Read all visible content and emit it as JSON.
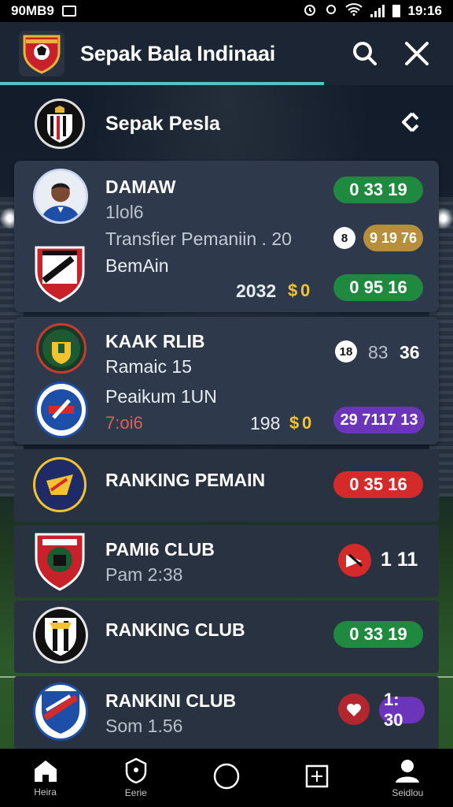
{
  "status_bar": {
    "left_text": "90MB9",
    "time": "19:16"
  },
  "app_bar": {
    "title": "Sepak Bala Indinaai",
    "search_icon": "search-icon",
    "close_icon": "close-icon"
  },
  "section": {
    "title": "Sepak Pesla",
    "action_icon": "share-icon"
  },
  "card1": {
    "name": "DAMAW",
    "line2": "1lol6",
    "line3": "Transfier Pemaniin . 20",
    "line4": "BemAin",
    "pill_top": "0  33  19",
    "dot_mid": "8",
    "pill_mid": "9 19 76",
    "year": "2032",
    "coin_value": "0",
    "pill_bottom": "0  95  16"
  },
  "card2": {
    "name": "KAAK RLIB",
    "line2": "Ramaic 15",
    "line3": "Peaikum 1UN",
    "line4": "7:oi6",
    "dot_top": "18",
    "score_top_a": "83",
    "score_top_b": "36",
    "num_bottom": "198",
    "coin_value": "0",
    "pill_bottom": "29 7117 13"
  },
  "rows": [
    {
      "title": "RANKING PEMAIN",
      "sub": "",
      "pill": "0  35  16",
      "pill_color": "#d42a2a"
    },
    {
      "title": "PAMI6 CLUB",
      "sub": "Pam 2:38",
      "badge": "1 11"
    },
    {
      "title": "RANKING CLUB",
      "sub": "",
      "pill": "0  33  19",
      "pill_color": "#1f8a3f"
    },
    {
      "title": "RANKINI CLUB",
      "sub": "Som 1.56",
      "pill": "1: 30",
      "pill_color": "#6a35b9"
    }
  ],
  "bottom_nav": [
    {
      "label": "Heira",
      "icon": "home-icon"
    },
    {
      "label": "Eerie",
      "icon": "shield-icon"
    },
    {
      "label": "",
      "icon": "circle-icon"
    },
    {
      "label": "",
      "icon": "add-square-icon"
    },
    {
      "label": "Seidlou",
      "icon": "profile-icon"
    }
  ]
}
